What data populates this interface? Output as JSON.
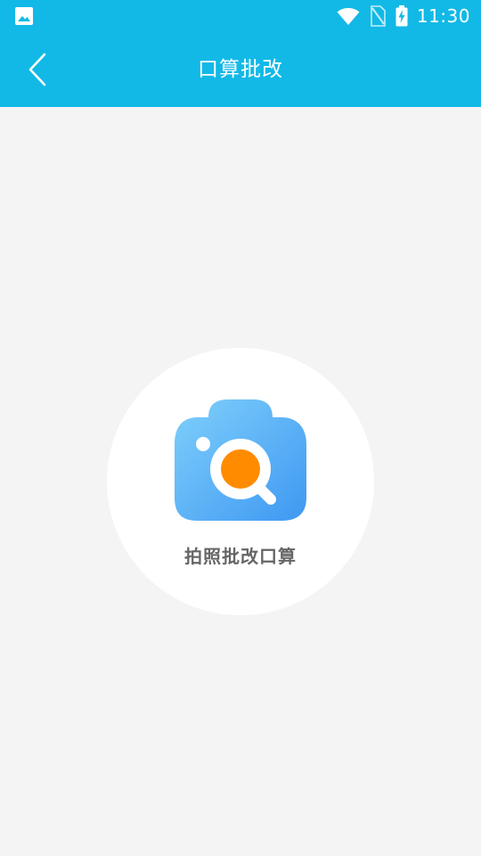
{
  "status_bar": {
    "time": "11:30",
    "icons": [
      "image-icon",
      "wifi-icon",
      "no-sim-icon",
      "battery-charging-icon"
    ]
  },
  "app_bar": {
    "title": "口算批改",
    "back_icon": "chevron-left-icon"
  },
  "main": {
    "action": {
      "label": "拍照批改口算",
      "icon": "camera-search-icon"
    }
  },
  "colors": {
    "primary": "#12b9e6",
    "background": "#f4f4f4",
    "card": "#ffffff",
    "camera_blue": "#4aa8f5",
    "lens_orange": "#ff8c00",
    "label_gray": "#666666"
  }
}
